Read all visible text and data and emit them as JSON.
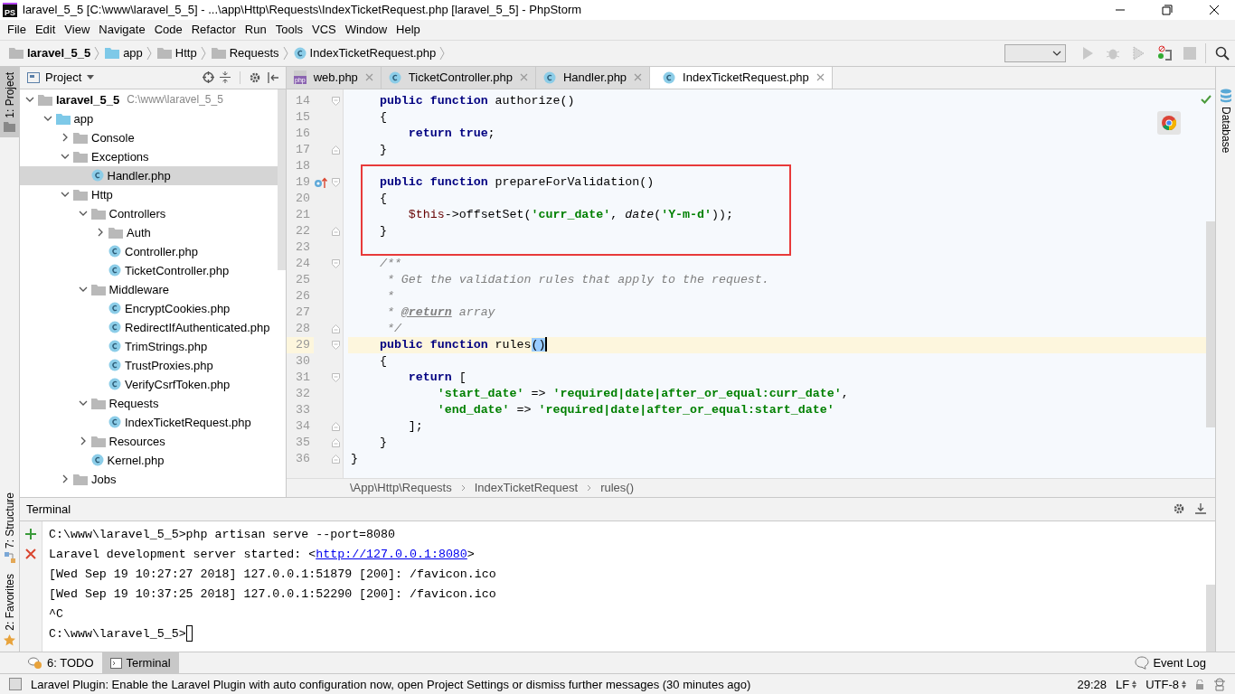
{
  "title_bar": {
    "logo": "PS",
    "title": "laravel_5_5 [C:\\www\\laravel_5_5] - ...\\app\\Http\\Requests\\IndexTicketRequest.php [laravel_5_5] - PhpStorm"
  },
  "menu": [
    "File",
    "Edit",
    "View",
    "Navigate",
    "Code",
    "Refactor",
    "Run",
    "Tools",
    "VCS",
    "Window",
    "Help"
  ],
  "nav_bar": {
    "crumbs": [
      {
        "label": "laravel_5_5",
        "kind": "project"
      },
      {
        "label": "app",
        "kind": "source"
      },
      {
        "label": "Http",
        "kind": "folder"
      },
      {
        "label": "Requests",
        "kind": "folder"
      },
      {
        "label": "IndexTicketRequest.php",
        "kind": "class"
      }
    ]
  },
  "left_stripe": {
    "top": [
      {
        "label": "1: Project",
        "selected": true
      }
    ],
    "bottom": [
      {
        "label": "7: Structure",
        "kind": "structure",
        "selected": false
      },
      {
        "label": "2: Favorites",
        "kind": "favorites",
        "selected": false
      }
    ]
  },
  "right_stripe": [
    {
      "label": "Database",
      "selected": false
    }
  ],
  "project_panel": {
    "title": "Project",
    "tree": [
      {
        "label": "laravel_5_5",
        "kind": "project",
        "path": "C:\\www\\laravel_5_5",
        "expanded": true,
        "selected": false,
        "children": [
          {
            "label": "app",
            "kind": "source",
            "expanded": true,
            "selected": false,
            "children": [
              {
                "label": "Console",
                "kind": "folder",
                "expanded": false,
                "selected": false
              },
              {
                "label": "Exceptions",
                "kind": "folder",
                "expanded": true,
                "selected": false,
                "children": [
                  {
                    "label": "Handler.php",
                    "kind": "class",
                    "selected": true
                  }
                ]
              },
              {
                "label": "Http",
                "kind": "folder",
                "expanded": true,
                "selected": false,
                "children": [
                  {
                    "label": "Controllers",
                    "kind": "folder",
                    "expanded": true,
                    "selected": false,
                    "children": [
                      {
                        "label": "Auth",
                        "kind": "folder",
                        "expanded": false,
                        "selected": false
                      },
                      {
                        "label": "Controller.php",
                        "kind": "class",
                        "selected": false
                      },
                      {
                        "label": "TicketController.php",
                        "kind": "class",
                        "selected": false
                      }
                    ]
                  },
                  {
                    "label": "Middleware",
                    "kind": "folder",
                    "expanded": true,
                    "selected": false,
                    "children": [
                      {
                        "label": "EncryptCookies.php",
                        "kind": "class",
                        "selected": false
                      },
                      {
                        "label": "RedirectIfAuthenticated.php",
                        "kind": "class",
                        "selected": false
                      },
                      {
                        "label": "TrimStrings.php",
                        "kind": "class",
                        "selected": false
                      },
                      {
                        "label": "TrustProxies.php",
                        "kind": "class",
                        "selected": false
                      },
                      {
                        "label": "VerifyCsrfToken.php",
                        "kind": "class",
                        "selected": false
                      }
                    ]
                  },
                  {
                    "label": "Requests",
                    "kind": "folder",
                    "expanded": true,
                    "selected": false,
                    "children": [
                      {
                        "label": "IndexTicketRequest.php",
                        "kind": "class",
                        "selected": false
                      }
                    ]
                  },
                  {
                    "label": "Resources",
                    "kind": "folder",
                    "expanded": false,
                    "selected": false
                  },
                  {
                    "label": "Kernel.php",
                    "kind": "class",
                    "selected": false
                  }
                ]
              },
              {
                "label": "Jobs",
                "kind": "folder",
                "expanded": false,
                "selected": false
              }
            ]
          }
        ]
      }
    ]
  },
  "editor": {
    "tabs": [
      {
        "label": "web.php",
        "kind": "php",
        "icon_label": "php",
        "selected": false
      },
      {
        "label": "TicketController.php",
        "kind": "class",
        "selected": false
      },
      {
        "label": "Handler.php",
        "kind": "class",
        "selected": false
      },
      {
        "label": "IndexTicketRequest.php",
        "kind": "class",
        "selected": true
      }
    ],
    "lines": [
      {
        "number": "14",
        "fold_start": true,
        "tokens": [
          {
            "kind": "kw",
            "t": "    public function"
          },
          {
            "kind": "plain",
            "t": " authorize()"
          }
        ]
      },
      {
        "number": "15",
        "tokens": [
          {
            "kind": "plain",
            "t": "    {"
          }
        ]
      },
      {
        "number": "16",
        "tokens": [
          {
            "kind": "kw",
            "t": "        return true"
          },
          {
            "kind": "plain",
            "t": ";"
          }
        ]
      },
      {
        "number": "17",
        "fold_end": true,
        "tokens": [
          {
            "kind": "plain",
            "t": "    }"
          }
        ]
      },
      {
        "number": "18"
      },
      {
        "number": "19",
        "fold_start": true,
        "overrides": true,
        "tokens": [
          {
            "kind": "kw",
            "t": "    public function"
          },
          {
            "kind": "plain",
            "t": " prepareForValidation()"
          }
        ]
      },
      {
        "number": "20",
        "tokens": [
          {
            "kind": "plain",
            "t": "    {"
          }
        ]
      },
      {
        "number": "21",
        "tokens": [
          {
            "kind": "var",
            "t": "        $this"
          },
          {
            "kind": "plain",
            "t": "->offsetSet("
          },
          {
            "kind": "str",
            "t": "'curr_date'"
          },
          {
            "kind": "plain",
            "t": ", "
          },
          {
            "kind": "call",
            "t": "date"
          },
          {
            "kind": "plain",
            "t": "("
          },
          {
            "kind": "str",
            "t": "'Y-m-d'"
          },
          {
            "kind": "plain",
            "t": "));"
          }
        ]
      },
      {
        "number": "22",
        "fold_end": true,
        "tokens": [
          {
            "kind": "plain",
            "t": "    }"
          }
        ]
      },
      {
        "number": "23"
      },
      {
        "number": "24",
        "fold_start": true,
        "tokens": [
          {
            "kind": "comment",
            "t": "    /**"
          }
        ]
      },
      {
        "number": "25",
        "tokens": [
          {
            "kind": "comment",
            "t": "     * Get the validation rules that apply to the request."
          }
        ]
      },
      {
        "number": "26",
        "tokens": [
          {
            "kind": "comment",
            "t": "     *"
          }
        ]
      },
      {
        "number": "27",
        "tokens": [
          {
            "kind": "comment",
            "t": "     * "
          },
          {
            "kind": "doctag",
            "t": "@return"
          },
          {
            "kind": "comment",
            "t": " array"
          }
        ]
      },
      {
        "number": "28",
        "fold_end": true,
        "tokens": [
          {
            "kind": "comment",
            "t": "     */"
          }
        ]
      },
      {
        "number": "29",
        "fold_start": true,
        "current": true,
        "tokens": [
          {
            "kind": "kw",
            "t": "    public function"
          },
          {
            "kind": "plain",
            "t": " rules"
          },
          {
            "kind": "match",
            "t": "()"
          }
        ]
      },
      {
        "number": "30",
        "tokens": [
          {
            "kind": "plain",
            "t": "    {"
          }
        ]
      },
      {
        "number": "31",
        "fold_start": true,
        "tokens": [
          {
            "kind": "kw",
            "t": "        return"
          },
          {
            "kind": "plain",
            "t": " ["
          }
        ]
      },
      {
        "number": "32",
        "tokens": [
          {
            "kind": "str",
            "t": "            'start_date'"
          },
          {
            "kind": "plain",
            "t": " => "
          },
          {
            "kind": "str",
            "t": "'required|date|after_or_equal:curr_date'"
          },
          {
            "kind": "plain",
            "t": ","
          }
        ]
      },
      {
        "number": "33",
        "tokens": [
          {
            "kind": "str",
            "t": "            'end_date'"
          },
          {
            "kind": "plain",
            "t": " => "
          },
          {
            "kind": "str",
            "t": "'required|date|after_or_equal:start_date'"
          }
        ]
      },
      {
        "number": "34",
        "fold_end": true,
        "tokens": [
          {
            "kind": "plain",
            "t": "        ];"
          }
        ]
      },
      {
        "number": "35",
        "fold_end": true,
        "tokens": [
          {
            "kind": "plain",
            "t": "    }"
          }
        ]
      },
      {
        "number": "36",
        "fold_end": true,
        "tokens": [
          {
            "kind": "plain",
            "t": "}"
          }
        ]
      }
    ],
    "breadcrumb": [
      "\\App\\Http\\Requests",
      "IndexTicketRequest",
      "rules()"
    ]
  },
  "terminal": {
    "title": "Terminal",
    "lines": [
      {
        "segments": [
          {
            "kind": "text",
            "text": "C:\\www\\laravel_5_5>php artisan serve --port=8080"
          }
        ]
      },
      {
        "segments": [
          {
            "kind": "text",
            "text": "Laravel development server started: <"
          },
          {
            "kind": "link",
            "text": "http://127.0.0.1:8080"
          },
          {
            "kind": "text",
            "text": ">"
          }
        ]
      },
      {
        "segments": [
          {
            "kind": "text",
            "text": "[Wed Sep 19 10:27:27 2018] 127.0.0.1:51879 [200]: /favicon.ico"
          }
        ]
      },
      {
        "segments": [
          {
            "kind": "text",
            "text": "[Wed Sep 19 10:37:25 2018] 127.0.0.1:52290 [200]: /favicon.ico"
          }
        ]
      },
      {
        "segments": [
          {
            "kind": "text",
            "text": "^C"
          }
        ]
      },
      {
        "segments": [
          {
            "kind": "text",
            "text": "C:\\www\\laravel_5_5>"
          }
        ],
        "cursor": true
      }
    ]
  },
  "tool_windows": [
    {
      "label": "6: TODO",
      "kind": "todo",
      "selected": false
    },
    {
      "label": "Terminal",
      "kind": "terminal",
      "selected": true
    }
  ],
  "event_log": "Event Log",
  "status_bar": {
    "message": "Laravel Plugin: Enable the Laravel Plugin with auto configuration now, open Project Settings or dismiss further messages (30 minutes ago)",
    "position": "29:28",
    "line_separator": "LF",
    "encoding": "UTF-8"
  }
}
